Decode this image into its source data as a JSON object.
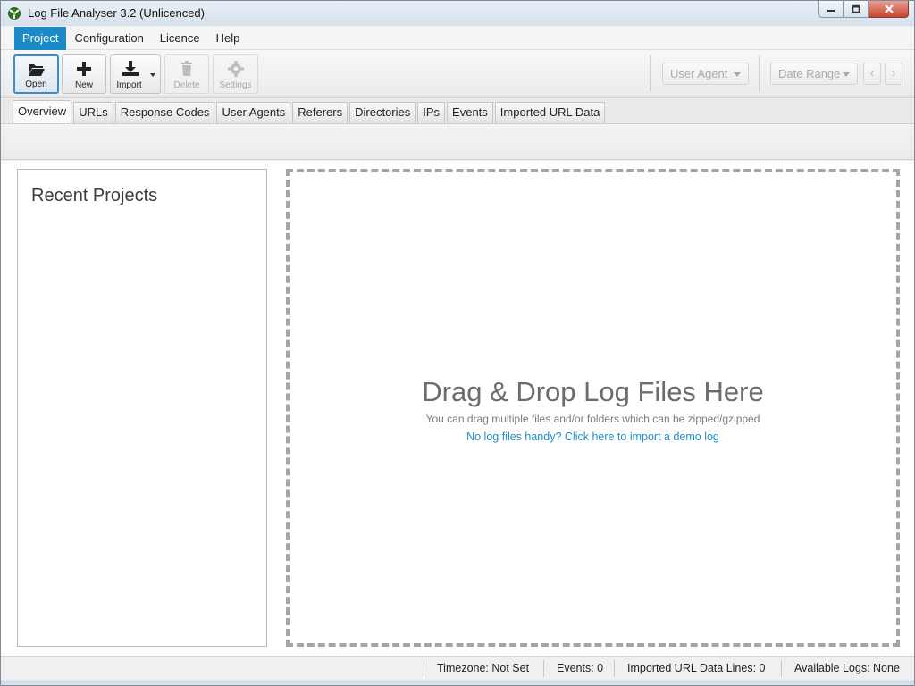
{
  "window": {
    "title": "Log File Analyser 3.2 (Unlicenced)"
  },
  "menu": {
    "items": [
      "Project",
      "Configuration",
      "Licence",
      "Help"
    ]
  },
  "toolbar": {
    "open_label": "Open",
    "new_label": "New",
    "import_label": "Import",
    "delete_label": "Delete",
    "settings_label": "Settings",
    "user_agent_label": "User Agent",
    "date_range_label": "Date Range",
    "prev_label": "‹",
    "next_label": "›"
  },
  "tabs": [
    "Overview",
    "URLs",
    "Response Codes",
    "User Agents",
    "Referers",
    "Directories",
    "IPs",
    "Events",
    "Imported URL Data"
  ],
  "recent": {
    "title": "Recent Projects"
  },
  "dropzone": {
    "title": "Drag & Drop Log Files Here",
    "subtitle": "You can drag multiple files and/or folders which can be zipped/gzipped",
    "link": "No log files handy? Click here to import a demo log"
  },
  "status": {
    "timezone": "Timezone:  Not Set",
    "events": "Events:  0",
    "imported": "Imported URL Data Lines:  0",
    "available": "Available Logs:  None"
  },
  "colors": {
    "accent": "#1c8ac7",
    "link": "#1f8fc6"
  }
}
